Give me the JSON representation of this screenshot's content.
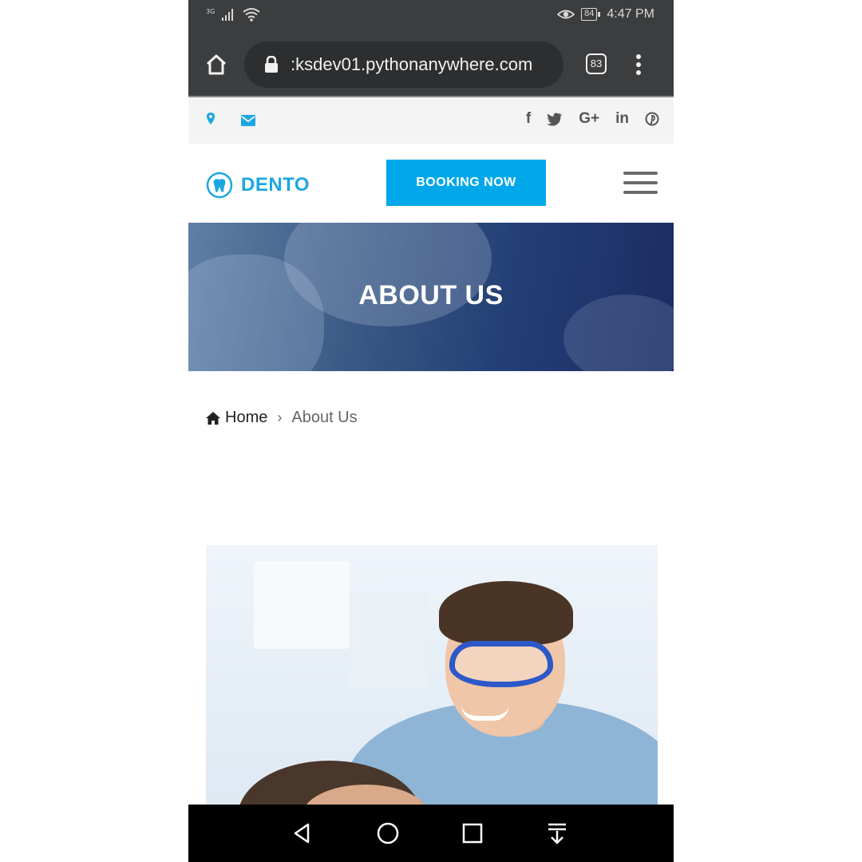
{
  "status_bar": {
    "network_label": "3G",
    "battery_level": "84",
    "time": "4:47 PM"
  },
  "browser": {
    "url": ":ksdev01.pythonanywhere.com",
    "tab_count": "83"
  },
  "topbar": {
    "icons": [
      "location-pin-icon",
      "envelope-icon"
    ],
    "social": [
      {
        "name": "facebook-icon",
        "glyph": "f"
      },
      {
        "name": "twitter-icon",
        "glyph": "🐦"
      },
      {
        "name": "google-plus-icon",
        "glyph": "G+"
      },
      {
        "name": "linkedin-icon",
        "glyph": "in"
      },
      {
        "name": "pinterest-icon",
        "glyph": "℗"
      }
    ]
  },
  "header": {
    "logo_text": "DENTO",
    "booking_label": "BOOKING NOW"
  },
  "hero": {
    "title": "ABOUT US"
  },
  "breadcrumb": {
    "home": "Home",
    "separator": "›",
    "current": "About Us"
  },
  "colors": {
    "accent": "#00a8e9",
    "browser_chrome": "#3c3d3f",
    "hero_overlay": "#1b2c62"
  }
}
